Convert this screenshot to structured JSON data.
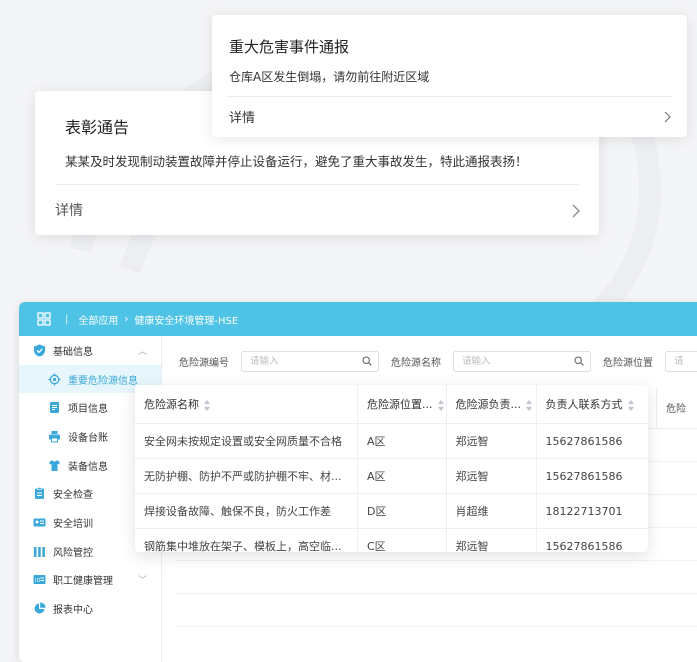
{
  "notice_card": {
    "title": "表彰通告",
    "body": "某某及时发现制动装置故障并停止设备运行，避免了重大事故发生，特此通报表扬！",
    "detail_label": "详情"
  },
  "alert_card": {
    "title": "重大危害事件通报",
    "body": "仓库A区发生倒塌，请勿前往附近区域",
    "detail_label": "详情"
  },
  "app": {
    "breadcrumb": {
      "separator": "|",
      "root": "全部应用",
      "current": "健康安全环境管理-HSE"
    },
    "sidebar": [
      {
        "label": "基础信息",
        "icon": "shield-check-icon",
        "expanded": true
      },
      {
        "label": "重要危险源信息",
        "icon": "target-icon",
        "child": true,
        "active": true
      },
      {
        "label": "项目信息",
        "icon": "document-icon",
        "child": true
      },
      {
        "label": "设备台账",
        "icon": "printer-icon",
        "child": true
      },
      {
        "label": "装备信息",
        "icon": "shirt-icon",
        "child": true
      },
      {
        "label": "安全检查",
        "icon": "clipboard-icon"
      },
      {
        "label": "安全培训",
        "icon": "id-card-icon"
      },
      {
        "label": "风险管控",
        "icon": "bar-chart-icon"
      },
      {
        "label": "职工健康管理",
        "icon": "id-badge-icon",
        "collapsed": true
      },
      {
        "label": "报表中心",
        "icon": "pie-chart-icon"
      }
    ],
    "filters": [
      {
        "label": "危险源编号",
        "placeholder": "请输入"
      },
      {
        "label": "危险源名称",
        "placeholder": "请输入"
      },
      {
        "label": "危险源位置",
        "placeholder": "请"
      }
    ],
    "bg_column_label": "危险"
  },
  "table": {
    "columns": [
      "危险源名称",
      "危险源位置...",
      "危险源负责...",
      "负责人联系方式"
    ],
    "rows": [
      [
        "安全网未按规定设置或安全网质量不合格",
        "A区",
        "郑远智",
        "15627861586"
      ],
      [
        "无防护棚、防护不严或防护棚不牢、材...",
        "A区",
        "郑远智",
        "15627861586"
      ],
      [
        "焊接设备故障、触保不良，防火工作差",
        "D区",
        "肖超维",
        "18122713701"
      ],
      [
        "钢筋集中堆放在架子、模板上，高空临...",
        "C区",
        "郑远智",
        "15627861586"
      ]
    ]
  },
  "colors": {
    "header": "#4ec3e6",
    "active_item": "#3aa8d8"
  }
}
